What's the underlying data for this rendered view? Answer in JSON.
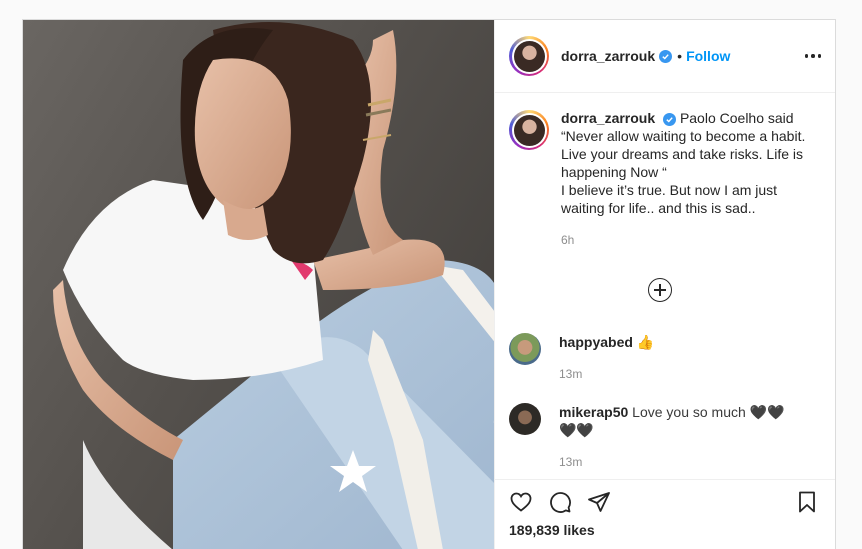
{
  "post": {
    "author": "dorra_zarrouk",
    "follow_label": "Follow",
    "separator": "•",
    "caption_text": "Paolo Coelho said “Never allow waiting to become a habit. Live your dreams and take risks. Life is happening Now “\nI believe it’s true. But now I am just waiting for life.. and this is sad..",
    "caption_time": "6h",
    "likes": "189,839 likes"
  },
  "comments": [
    {
      "username": "happyabed",
      "text": "👍",
      "time": "13m"
    },
    {
      "username": "mikerap50",
      "text": "Love you so much 🖤🖤\n🖤🖤",
      "time": "13m"
    }
  ],
  "icons": {
    "like": "heart-icon",
    "comment": "comment-icon",
    "share": "share-icon",
    "save": "bookmark-icon",
    "more": "more-options-icon",
    "load_more": "plus-circle-icon"
  },
  "colors": {
    "link": "#0095f6",
    "verified": "#3897f0",
    "muted": "#8e8e8e"
  }
}
